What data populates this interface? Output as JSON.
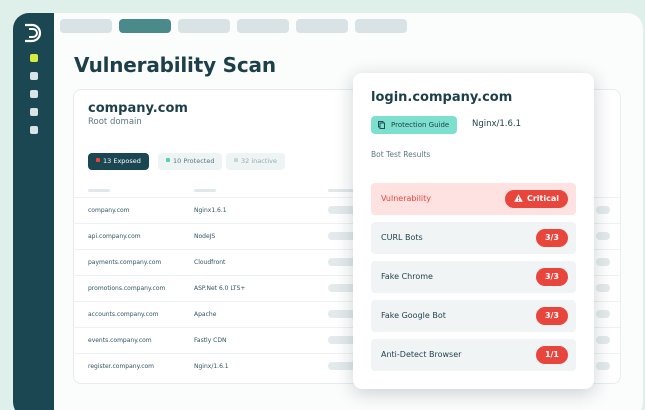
{
  "app": {
    "logo_icon": "logo-d-icon"
  },
  "tabs": [
    {
      "active": false
    },
    {
      "active": true
    },
    {
      "active": false
    },
    {
      "active": false
    },
    {
      "active": false
    },
    {
      "active": false
    }
  ],
  "page": {
    "title": "Vulnerability Scan"
  },
  "root": {
    "domain": "company.com",
    "subtitle": "Root domain",
    "filters": {
      "exposed": "13 Exposed",
      "protected": "10 Protected",
      "inactive": "32 inactive"
    },
    "rows": [
      {
        "domain": "company.com",
        "server": "Nginx1.6.1"
      },
      {
        "domain": "api.company.com",
        "server": "NodeJS"
      },
      {
        "domain": "payments.company.com",
        "server": "Cloudfront"
      },
      {
        "domain": "promotions.company.com",
        "server": "ASP.Net 6.0 LTS+"
      },
      {
        "domain": "accounts.company.com",
        "server": "Apache"
      },
      {
        "domain": "events.company.com",
        "server": "Fastly CDN"
      },
      {
        "domain": "register.company.com",
        "server": "Nginx/1.6.1"
      }
    ]
  },
  "popup": {
    "title": "login.company.com",
    "guide_label": "Protection Guide",
    "guide_icon": "copy-icon",
    "server": "Nginx/1.6.1",
    "section_label": "Bot Test Results",
    "tests": [
      {
        "label": "Vulnerability",
        "badge": "Critical",
        "critical": true
      },
      {
        "label": "CURL Bots",
        "badge": "3/3"
      },
      {
        "label": "Fake Chrome",
        "badge": "3/3"
      },
      {
        "label": "Fake Google Bot",
        "badge": "3/3"
      },
      {
        "label": "Anti-Detect Browser",
        "badge": "1/1"
      }
    ]
  },
  "colors": {
    "sidebar": "#1b4753",
    "accent_teal": "#7de0cf",
    "active_dot": "#d8ec3e",
    "critical_red": "#e8453c",
    "background": "#dff0ea"
  }
}
